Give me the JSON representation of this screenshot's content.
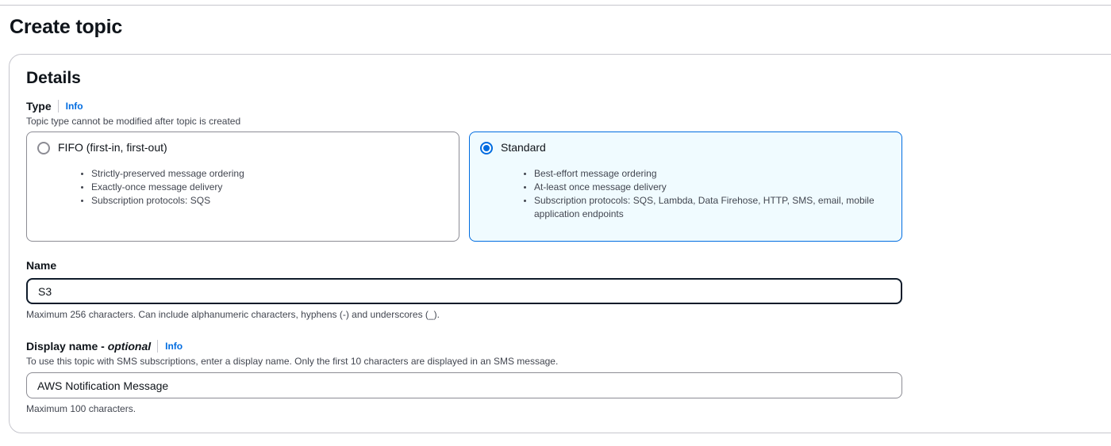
{
  "page": {
    "title": "Create topic"
  },
  "details": {
    "title": "Details",
    "type": {
      "label": "Type",
      "info": "Info",
      "description": "Topic type cannot be modified after topic is created",
      "options": [
        {
          "title": "FIFO (first-in, first-out)",
          "selected": false,
          "bullets": [
            "Strictly-preserved message ordering",
            "Exactly-once message delivery",
            "Subscription protocols: SQS"
          ]
        },
        {
          "title": "Standard",
          "selected": true,
          "bullets": [
            "Best-effort message ordering",
            "At-least once message delivery",
            "Subscription protocols: SQS, Lambda, Data Firehose, HTTP, SMS, email, mobile application endpoints"
          ]
        }
      ]
    },
    "name": {
      "label": "Name",
      "value": "S3",
      "hint": "Maximum 256 characters. Can include alphanumeric characters, hyphens (-) and underscores (_)."
    },
    "display_name": {
      "label": "Display name - ",
      "optional": "optional",
      "info": "Info",
      "description": "To use this topic with SMS subscriptions, enter a display name. Only the first 10 characters are displayed in an SMS message.",
      "value": "AWS Notification Message",
      "hint": "Maximum 100 characters."
    }
  },
  "colors": {
    "accent": "#006ce0",
    "selected_tile_bg": "#f0fbff",
    "border": "#8c8c94",
    "text": "#0f141a",
    "muted_text": "#424650"
  }
}
